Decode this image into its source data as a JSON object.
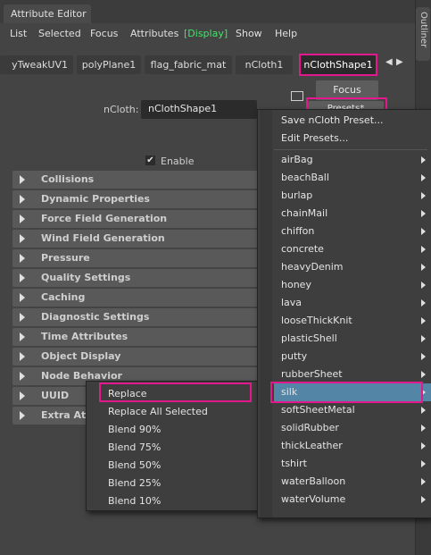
{
  "window": {
    "title": "Attribute Editor",
    "side_tab": "Outliner"
  },
  "menubar": [
    "List",
    "Selected",
    "Focus",
    "Attributes",
    "[Display]",
    "Show",
    "Help"
  ],
  "node_tabs": [
    "yTweakUV1",
    "polyPlane1",
    "flag_fabric_mat",
    "nCloth1",
    "nClothShape1"
  ],
  "buttons": {
    "focus": "Focus",
    "presets": "Presets*"
  },
  "ncloth_field": {
    "label": "nCloth:",
    "value": "nClothShape1"
  },
  "enable": {
    "label": "Enable",
    "checked": true
  },
  "sections": [
    "Collisions",
    "Dynamic Properties",
    "Force Field Generation",
    "Wind Field Generation",
    "Pressure",
    "Quality Settings",
    "Caching",
    "Diagnostic Settings",
    "Time Attributes",
    "Object Display",
    "Node Behavior",
    "UUID",
    "Extra Attributes"
  ],
  "presets_menu": {
    "actions": [
      "Save nCloth Preset...",
      "Edit Presets..."
    ],
    "items": [
      "airBag",
      "beachBall",
      "burlap",
      "chainMail",
      "chiffon",
      "concrete",
      "heavyDenim",
      "honey",
      "lava",
      "looseThickKnit",
      "plasticShell",
      "putty",
      "rubberSheet",
      "silk",
      "softSheetMetal",
      "solidRubber",
      "thickLeather",
      "tshirt",
      "waterBalloon",
      "waterVolume"
    ],
    "selected": "silk"
  },
  "blend_menu": {
    "items": [
      "Replace",
      "Replace All Selected",
      "Blend 90%",
      "Blend 75%",
      "Blend 50%",
      "Blend 25%",
      "Blend 10%"
    ],
    "highlighted": "Replace"
  },
  "highlight_color": "#e1198c",
  "selection_color": "#5285a6"
}
